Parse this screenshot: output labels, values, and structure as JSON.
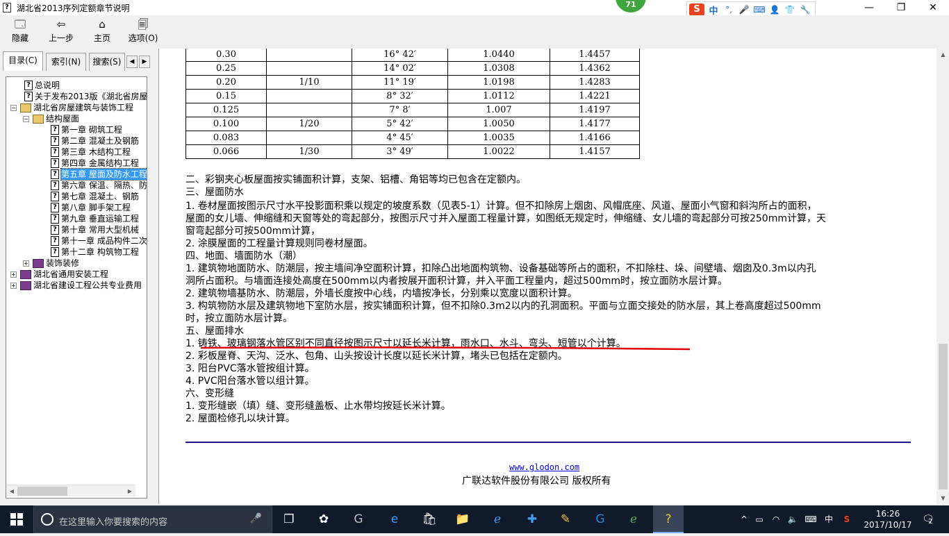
{
  "window": {
    "title": "湖北省2013序列定额章节说明",
    "minimize_glyph": "—",
    "maximize_glyph": "❐",
    "close_glyph": "✕"
  },
  "overlay": {
    "badge_value": "71",
    "ime_logo": "S",
    "ime_items": [
      "中",
      "°,",
      "🎤",
      "⌨",
      "👤",
      "👕",
      "🔧"
    ]
  },
  "toolbar": {
    "buttons": [
      {
        "label": "隐藏",
        "icon": "hide-icon",
        "glyph": "🗔"
      },
      {
        "label": "上一步",
        "icon": "back-arrow-icon",
        "glyph": "⇦"
      },
      {
        "label": "主页",
        "icon": "home-icon",
        "glyph": "⌂"
      },
      {
        "label": "选项(O)",
        "icon": "options-icon",
        "glyph": "🗐"
      }
    ]
  },
  "sidebar": {
    "tabs": [
      {
        "label": "目录(C)",
        "active": true
      },
      {
        "label": "索引(N)",
        "active": false
      },
      {
        "label": "搜索(S)",
        "active": false
      }
    ],
    "tab_prev": "◀",
    "tab_next": "▶",
    "tree": [
      {
        "label": "总说明",
        "type": "page",
        "level": 1
      },
      {
        "label": "关于发布2013版《湖北省房屋",
        "type": "page",
        "level": 1
      },
      {
        "label": "湖北省房屋建筑与装饰工程",
        "type": "book-open",
        "level": 0,
        "expander": "−"
      },
      {
        "label": "结构屋面",
        "type": "book-open",
        "level": 1,
        "expander": "−"
      },
      {
        "label": "第一章  砌筑工程",
        "type": "page",
        "level": 2
      },
      {
        "label": "第二章  混凝土及钢筋",
        "type": "page",
        "level": 2
      },
      {
        "label": "第三章  木结构工程",
        "type": "page",
        "level": 2
      },
      {
        "label": "第四章  金属结构工程",
        "type": "page",
        "level": 2
      },
      {
        "label": "第五章  屋面及防水工程",
        "type": "page",
        "level": 2,
        "selected": true
      },
      {
        "label": "第六章  保温、隔热、防",
        "type": "page",
        "level": 2
      },
      {
        "label": "第七章  混凝土、钢筋",
        "type": "page",
        "level": 2
      },
      {
        "label": "第八章  脚手架工程",
        "type": "page",
        "level": 2
      },
      {
        "label": "第九章  垂直运输工程",
        "type": "page",
        "level": 2
      },
      {
        "label": "第十章  常用大型机械",
        "type": "page",
        "level": 2
      },
      {
        "label": "第十一章  成品构件二次",
        "type": "page",
        "level": 2
      },
      {
        "label": "第十二章  构筑物工程",
        "type": "page",
        "level": 2
      },
      {
        "label": "装饰装修",
        "type": "book",
        "level": 1,
        "expander": "+"
      },
      {
        "label": "湖北省通用安装工程",
        "type": "book",
        "level": 0,
        "expander": "+"
      },
      {
        "label": "湖北省建设工程公共专业费用",
        "type": "book",
        "level": 0,
        "expander": "+"
      }
    ]
  },
  "content": {
    "table_rows": [
      [
        "0.30",
        "",
        "16° 42′",
        "1.0440",
        "1.4457"
      ],
      [
        "0.25",
        "",
        "14° 02′",
        "1.0308",
        "1.4362"
      ],
      [
        "0.20",
        "1/10",
        "11° 19′",
        "1.0198",
        "1.4283"
      ],
      [
        "0.15",
        "",
        "8° 32′",
        "1.0112",
        "1.4221"
      ],
      [
        "0.125",
        "",
        "7° 8′",
        "1.007",
        "1.4197"
      ],
      [
        "0.100",
        "1/20",
        "5° 42′",
        "1.0050",
        "1.4177"
      ],
      [
        "0.083",
        "",
        "4° 45′",
        "1.0035",
        "1.4166"
      ],
      [
        "0.066",
        "1/30",
        "3° 49′",
        "1.0022",
        "1.4157"
      ]
    ],
    "lines": [
      "二、彩钢夹心板屋面按实铺面积计算，支架、铝槽、角铝等均已包含在定额内。",
      "三、屋面防水",
      "1. 卷材屋面按图示尺寸水平投影面积乘以规定的坡度系数（见表5-1）计算。但不扣除房上烟囱、风帽底座、风道、屋面小气窗和斜沟所占的面积，",
      "屋面的女儿墙、伸缩缝和天窗等处的弯起部分，按图示尺寸并入屋面工程量计算，如图纸无规定时，伸缩缝、女儿墙的弯起部分可按250mm计算，天",
      "窗弯起部分可按500mm计算，",
      "2. 涂膜屋面的工程量计算规则同卷材屋面。",
      "四、地面、墙面防水（潮）",
      "1. 建筑物地面防水、防潮层，按主墙间净空面积计算，扣除凸出地面构筑物、设备基础等所占的面积，不扣除柱、垛、间壁墙、烟囱及0.3m以内孔",
      "洞所占面积。与墙面连接处高度在500mm以内者按展开面积计算，并入平面工程量内，超过500mm时，按立面防水层计算。",
      "2. 建筑物墙基防水、防潮层，外墙长度按中心线，内墙按净长，分别乘以宽度以面积计算。",
      "3. 构筑物防水层及建筑物地下室防水层，按实铺面积计算，但不扣除0.3m2以内的孔洞面积。平面与立面交接处的防水层，其上卷高度超过500mm",
      "时，按立面防水层计算。",
      "五、屋面排水",
      "1. 铸铁、玻璃钢落水管区别不同直径按图示尺寸以延长米计算，雨水口、水斗、弯头、短管以个计算。",
      "2. 彩板屋脊、天沟、泛水、包角、山头按设计长度以延长米计算，堵头已包括在定额内。",
      "3. 阳台PVC落水管按组计算。",
      "4. PVC阳台落水管以组计算。",
      "六、变形缝",
      "1. 变形缝嵌（填）缝、变形缝盖板、止水带均按延长米计算。",
      "2. 屋面检修孔以块计算。"
    ],
    "footer_link": "www.glodon.com",
    "footer_copyright": "广联达软件股份有限公司 版权所有",
    "highlight_color": "#e00000",
    "rule_color": "#1a1a8c"
  },
  "taskbar": {
    "search_placeholder": "在这里输入你要搜索的内容",
    "apps": [
      {
        "name": "task-view",
        "glyph": "❒"
      },
      {
        "name": "app-pinwheel",
        "glyph": "✿"
      },
      {
        "name": "app-spiral",
        "glyph": "G"
      },
      {
        "name": "edge",
        "glyph": "e"
      },
      {
        "name": "store",
        "glyph": "🛍"
      },
      {
        "name": "file-explorer",
        "glyph": "📁"
      },
      {
        "name": "internet-explorer",
        "glyph": "ℯ"
      },
      {
        "name": "app-plus",
        "glyph": "✚"
      },
      {
        "name": "notepad-app",
        "glyph": "✎"
      },
      {
        "name": "glodon-g",
        "glyph": "G"
      },
      {
        "name": "app-green",
        "glyph": "ℯ"
      },
      {
        "name": "help-viewer",
        "glyph": "?",
        "active": true
      }
    ],
    "tray": {
      "chevron": "^",
      "ime_lang": "中",
      "ime_logo": "S"
    },
    "time": "16:26",
    "date": "2017/10/17",
    "notification_count": "2"
  }
}
